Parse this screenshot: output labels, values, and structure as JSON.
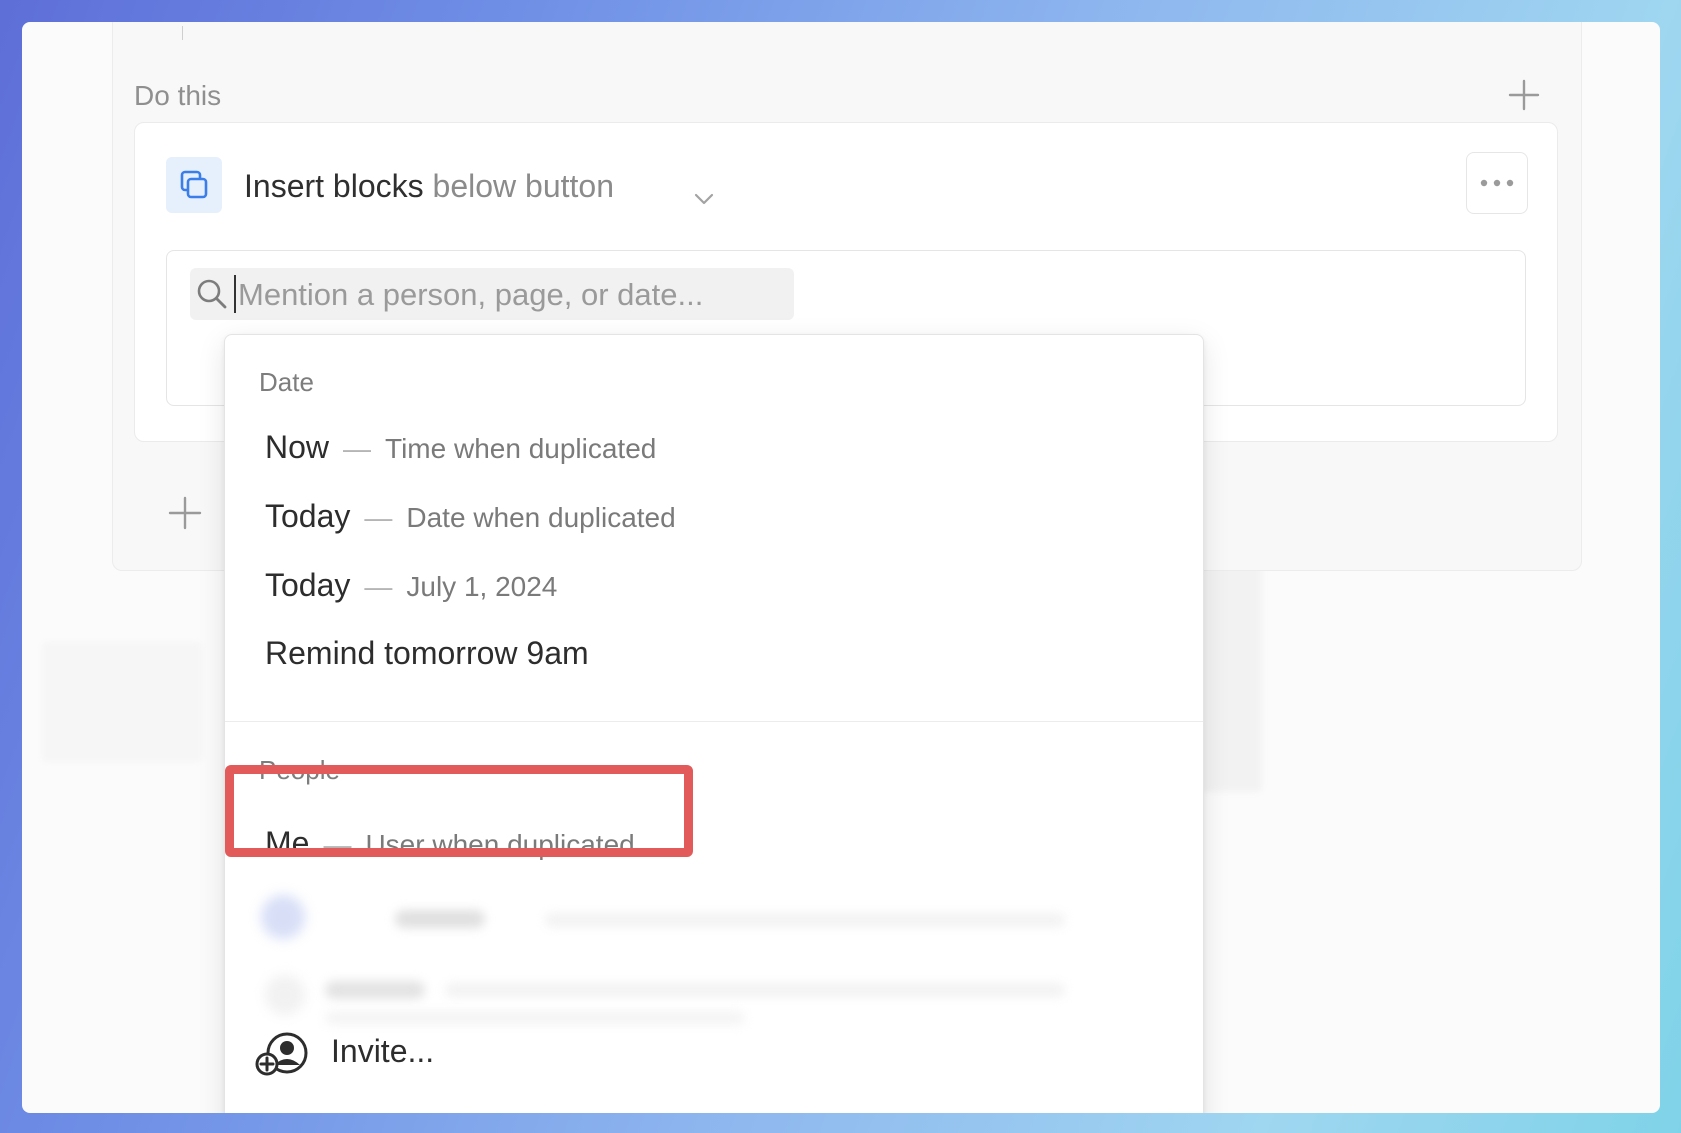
{
  "workflow": {
    "section_label": "Do this",
    "action": {
      "title_main": "Insert blocks",
      "title_sub": "below button",
      "icon": "copy-blocks-icon",
      "more_icon": "more-horizontal-icon"
    },
    "mention_input": {
      "placeholder": "Mention a person, page, or date..."
    },
    "add_icon": "plus-icon"
  },
  "mention_menu": {
    "date_header": "Date",
    "date_items": [
      {
        "label": "Now",
        "desc": "Time when duplicated"
      },
      {
        "label": "Today",
        "desc": "Date when duplicated"
      },
      {
        "label": "Today",
        "desc": "July 1, 2024"
      },
      {
        "label": "Remind tomorrow 9am"
      }
    ],
    "people_header": "People",
    "people_items": [
      {
        "label": "Me",
        "desc": "User when duplicated",
        "highlighted": true
      }
    ],
    "invite_label": "Invite...",
    "separator": "—"
  },
  "colors": {
    "highlight_border": "#e35a5a",
    "action_icon_bg": "#e6effc",
    "action_icon_fg": "#3b7de9"
  }
}
